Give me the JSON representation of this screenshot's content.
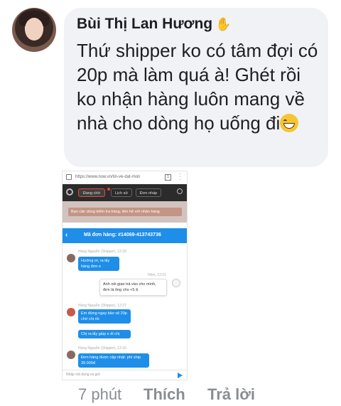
{
  "comment": {
    "author": "Bùi Thị Lan Hương",
    "text": "Thứ shipper ko có tâm đợi có 20p mà làm quá à! Ghét rồi ko nhận hàng luôn mang về nhà cho dòng họ uống đi",
    "emoji": "grinning-sweat-face"
  },
  "attachment": {
    "url": "https://www.now.vn/tin-ve-dat-mon",
    "tabs_count": "1",
    "nav": [
      "Đang chờ",
      "Lịch sử",
      "Đơn nháp"
    ],
    "banner": "Bạn cần dùng kiểm tra hàng, liên hệ với nhân hàng",
    "order_label": "Mã đơn hàng: #14069-413743736",
    "messages": [
      {
        "side": "left",
        "meta": "Hùng Nguyễn (Shipper), 12:18",
        "text": "Hướng ơi, ra lấy hàng đơn e"
      },
      {
        "side": "right",
        "meta": "Hôm, 12:21",
        "text": "Anh nói giao trả vào cho mình, đơn là ông cho +5 ã"
      },
      {
        "side": "left",
        "meta": "Hùng Nguyễn (Shipper), 12:27",
        "text": "Em đứng ngay bảo vệ 20p chờ chị rồi"
      },
      {
        "side": "left",
        "meta": "",
        "text": "Chị ra lấy giúp e đi chị"
      },
      {
        "side": "left",
        "meta": "Hùng Nguyễn (Shipper), 12:33",
        "text": "Đơn hàng được cập nhật: phí ship 39.000đ"
      }
    ],
    "input_placeholder": "Nhập nội dung và gửi"
  },
  "actions": {
    "time": "7 phút",
    "like": "Thích",
    "reply": "Trả lời"
  },
  "colors": {
    "bubble": "#f0f2f5",
    "accent_blue": "#1e8ee8",
    "nav_dark": "#2b2b2b",
    "muted_text": "#8a8d91"
  }
}
